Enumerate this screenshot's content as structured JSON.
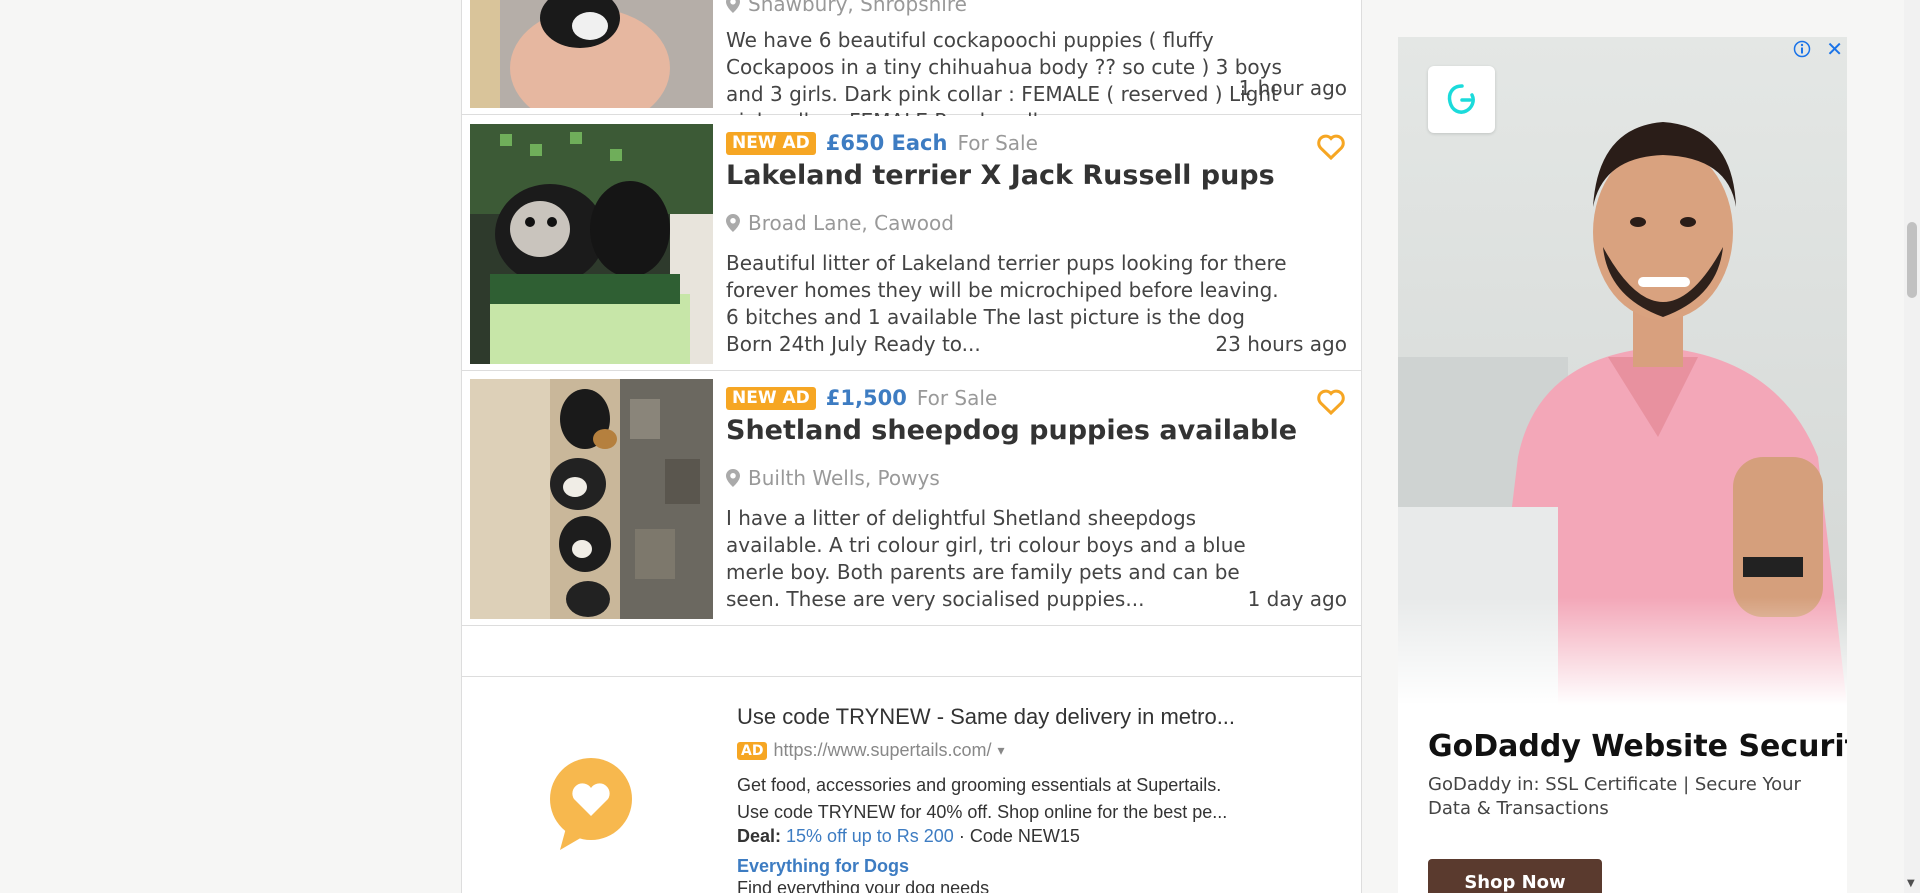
{
  "listings": [
    {
      "location": "Shawbury, Shropshire",
      "description": "We have 6 beautiful cockapoochi puppies ( fluffy Cockapoos in a tiny chihuahua body ?? so cute ) 3 boys and 3 girls. Dark pink collar : FEMALE ( reserved ) Light pink collar : FEMALE Purple collar...",
      "age": "1 hour ago"
    },
    {
      "badge": "NEW AD",
      "price": "£650 Each",
      "status": "For Sale",
      "title": "Lakeland terrier X Jack Russell pups",
      "location": "Broad Lane, Cawood",
      "description": "Beautiful litter of Lakeland terrier pups looking for there forever homes they will be microchiped before leaving. 6 bitches and 1 available The last picture is the dog Born 24th July Ready to...",
      "age": "23 hours ago"
    },
    {
      "badge": "NEW AD",
      "price": "£1,500",
      "status": "For Sale",
      "title": "Shetland sheepdog puppies available",
      "location": "Builth Wells, Powys",
      "description": "I have a litter of delightful Shetland sheepdogs available. A tri colour girl, tri colour boys and a blue merle boy. Both parents are family pets and can be seen. These are very socialised puppies...",
      "age": "1 day ago"
    }
  ],
  "text_ad": {
    "title": "Use code TRYNEW - Same day delivery in metro...",
    "tag": "AD",
    "url": "https://www.supertails.com/",
    "caret": "▾",
    "desc_line1": "Get food, accessories and grooming essentials at Supertails.",
    "desc_line2": "Use code TRYNEW for 40% off. Shop online for the best pe...",
    "deal_label": "Deal:",
    "deal_link": "15% off up to Rs 200",
    "deal_code": " · Code NEW15",
    "sitelink": "Everything for Dogs",
    "sitelink_desc": "Find everything your dog needs"
  },
  "side_ad": {
    "headline": "GoDaddy Website Security",
    "subtext": "GoDaddy in: SSL Certificate | Secure Your Data & Transactions",
    "cta": "Shop Now",
    "close": "✕"
  },
  "colors": {
    "badge": "#f6a623",
    "price": "#3d7cc2",
    "heart": "#f6a623",
    "cta": "#5a3a2e"
  },
  "icons": [
    "location-pin-icon",
    "heart-icon",
    "adchoices-icon",
    "close-icon",
    "godaddy-logo-icon"
  ]
}
